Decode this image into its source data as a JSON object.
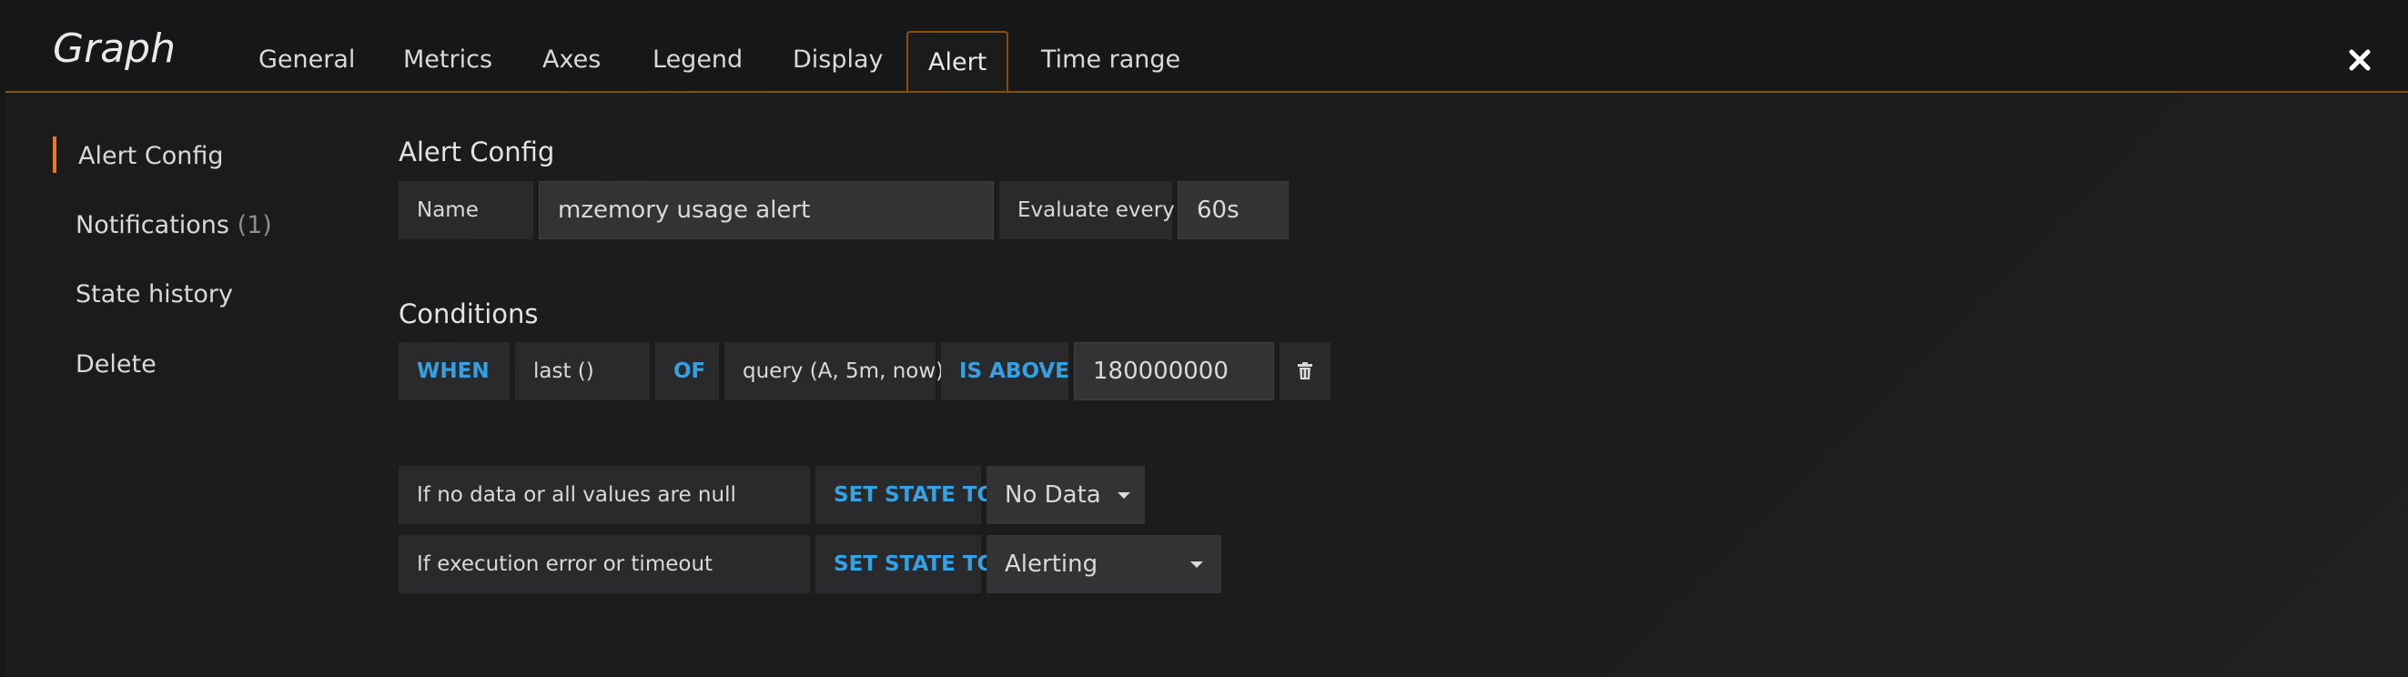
{
  "header": {
    "title": "Graph",
    "tabs": [
      "General",
      "Metrics",
      "Axes",
      "Legend",
      "Display",
      "Alert",
      "Time range"
    ],
    "close_icon": "close-icon"
  },
  "sidebar": {
    "items": [
      {
        "label": "Alert Config",
        "active": true
      },
      {
        "label": "Notifications",
        "count": "(1)"
      },
      {
        "label": "State history"
      },
      {
        "label": "Delete"
      }
    ]
  },
  "alert_config": {
    "title": "Alert Config",
    "name_label": "Name",
    "name_value": "mzemory usage alert",
    "evaluate_label": "Evaluate every",
    "evaluate_value": "60s"
  },
  "conditions": {
    "title": "Conditions",
    "when_kw": "WHEN",
    "reducer": "last ()",
    "of_kw": "OF",
    "query": "query (A, 5m, now)",
    "evaluator_kw": "IS ABOVE",
    "threshold": "180000000",
    "trash_icon": "trash-icon"
  },
  "state_rules": [
    {
      "condition": "If no data or all values are null",
      "action_kw": "SET STATE TO",
      "value": "No Data"
    },
    {
      "condition": "If execution error or timeout",
      "action_kw": "SET STATE TO",
      "value": "Alerting"
    }
  ],
  "colors": {
    "accent": "#eb7b18",
    "keyword": "#33a2e5",
    "background": "#161719"
  }
}
